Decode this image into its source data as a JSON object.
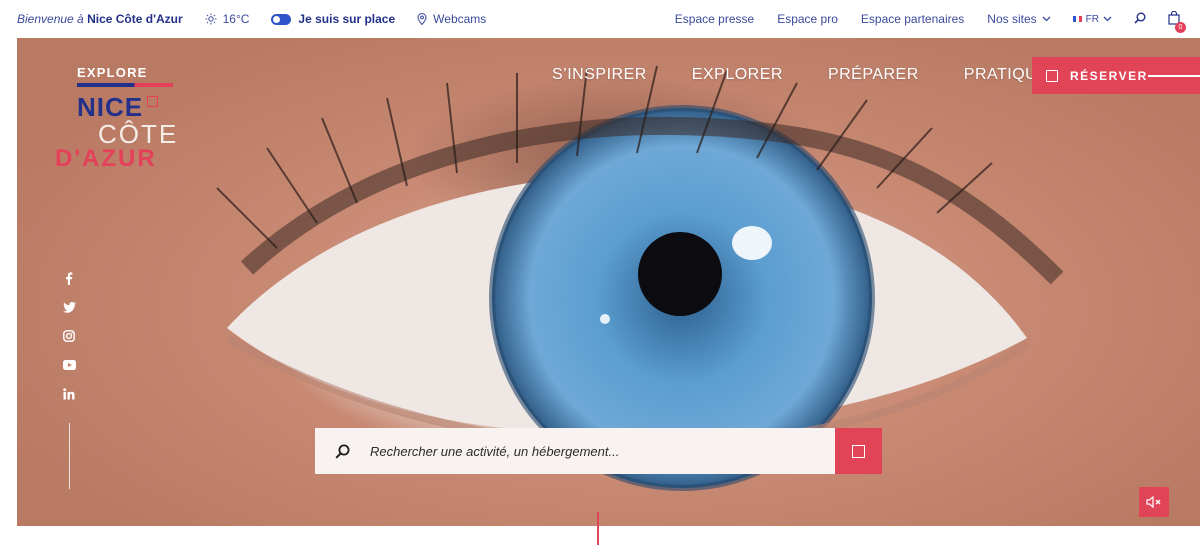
{
  "topbar": {
    "welcome_prefix": "Bienvenue à",
    "welcome_place": "Nice Côte d'Azur",
    "temperature": "16°C",
    "onsite_label": "Je suis sur place",
    "webcams_label": "Webcams",
    "links": [
      "Espace presse",
      "Espace pro",
      "Espace partenaires"
    ],
    "nos_sites_label": "Nos sites",
    "language": "FR",
    "cart_count": "0"
  },
  "logo": {
    "explore": "EXPLORE",
    "line1": "NICE",
    "line2": "CÔTE",
    "line3": "D'AZUR"
  },
  "nav": {
    "items": [
      "S’INSPIRER",
      "EXPLORER",
      "PRÉPARER",
      "PRATIQUE"
    ],
    "reserve_label": "RÉSERVER"
  },
  "social": {
    "icons": [
      "facebook-icon",
      "twitter-icon",
      "instagram-icon",
      "youtube-icon",
      "linkedin-icon"
    ]
  },
  "search": {
    "placeholder": "Rechercher une activité, un hébergement..."
  },
  "colors": {
    "brand_blue": "#23318a",
    "accent_red": "#e24457"
  }
}
